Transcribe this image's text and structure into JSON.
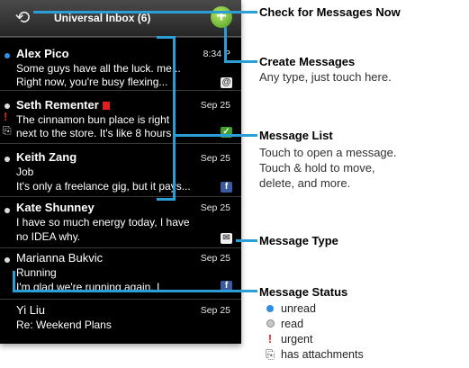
{
  "header": {
    "title": "Universal Inbox (6)",
    "refresh_glyph": "⟲",
    "compose_glyph": "+"
  },
  "messages": [
    {
      "sender": "Alex Pico",
      "date": "8:34 P",
      "line1": "Some guys have all the luck. me...",
      "line2": "Right now, you're busy flexing...",
      "status": "unread",
      "type": "email-icon"
    },
    {
      "sender": "Seth Rementer",
      "date": "Sep 25",
      "line1": "The cinnamon bun place is right",
      "line2": "next to the store. It's like 8 hours",
      "status": "read",
      "urgent": true,
      "attachment": true,
      "flag": true,
      "type": "sms-icon"
    },
    {
      "sender": "Keith Zang",
      "date": "Sep 25",
      "line1": "Job",
      "line2": "It's only a freelance gig, but it pays...",
      "status": "read",
      "type": "facebook-icon"
    },
    {
      "sender": "Kate Shunney",
      "date": "Sep 25",
      "line1": "I have so much energy today, I have",
      "line2": "no IDEA why.",
      "status": "read",
      "type": "mail-icon"
    },
    {
      "sender": "Marianna Bukvic",
      "date": "Sep 25",
      "line1": "Running",
      "line2": "I'm glad we're running again. I",
      "status": "read",
      "type": "facebook-icon"
    },
    {
      "sender": "Yi Liu",
      "date": "Sep 25",
      "line1": "Re: Weekend Plans",
      "line2": "",
      "status": "none"
    }
  ],
  "icons": {
    "email": "@",
    "sms": "✓",
    "facebook": "f",
    "mail": "✉",
    "urgent": "!",
    "attachment": "⎘"
  },
  "callouts": {
    "check": {
      "title": "Check for Messages Now"
    },
    "create": {
      "title": "Create Messages",
      "text": "Any type, just touch here."
    },
    "list": {
      "title": "Message List",
      "text1": "Touch to open a message.",
      "text2": "Touch & hold to move,",
      "text3": "delete, and more."
    },
    "type": {
      "title": "Message Type"
    },
    "status": {
      "title": "Message Status"
    }
  },
  "legend": {
    "unread": "unread",
    "read": "read",
    "urgent": "urgent",
    "attachments": "has attachments"
  },
  "colors": {
    "accent": "#2a9fd6",
    "unread": "#2f8fe8",
    "urgent": "#e02020",
    "compose": "#4a9a1c"
  }
}
